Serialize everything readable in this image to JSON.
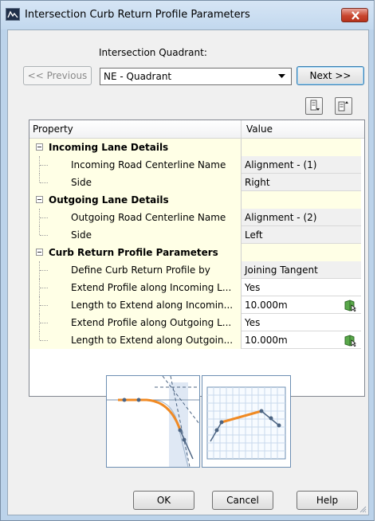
{
  "window": {
    "title": "Intersection Curb Return Profile Parameters",
    "icon": "dialog-app-icon",
    "close_icon": "close-icon"
  },
  "quadrant": {
    "label": "Intersection Quadrant:",
    "selected": "NE - Quadrant",
    "previous_label": "<< Previous",
    "next_label": "Next >>"
  },
  "grid": {
    "header_property": "Property",
    "header_value": "Value",
    "rows": [
      {
        "type": "category",
        "label": "Incoming Lane Details",
        "value": ""
      },
      {
        "type": "item",
        "label": "Incoming Road Centerline Name",
        "value": "Alignment - (1)",
        "readonly": true
      },
      {
        "type": "item",
        "label": "Side",
        "value": "Right",
        "readonly": true
      },
      {
        "type": "category",
        "label": "Outgoing Lane Details",
        "value": ""
      },
      {
        "type": "item",
        "label": "Outgoing Road Centerline Name",
        "value": "Alignment - (2)",
        "readonly": true
      },
      {
        "type": "item",
        "label": "Side",
        "value": "Left",
        "readonly": true
      },
      {
        "type": "category",
        "label": "Curb Return Profile Parameters",
        "value": ""
      },
      {
        "type": "item",
        "label": "Define Curb Return Profile by",
        "value": "Joining Tangent",
        "readonly": true
      },
      {
        "type": "item",
        "label": "Extend Profile along Incoming L...",
        "value": "Yes",
        "readonly": false
      },
      {
        "type": "item",
        "label": "Length to Extend along Incomin...",
        "value": "10.000m",
        "readonly": false,
        "pick": true
      },
      {
        "type": "item",
        "label": "Extend Profile along Outgoing L...",
        "value": "Yes",
        "readonly": false
      },
      {
        "type": "item",
        "label": "Length to Extend along Outgoin...",
        "value": "10.000m",
        "readonly": false,
        "pick": true
      }
    ]
  },
  "toolbar": {
    "collapse_icon": "collapse-all-icon",
    "expand_icon": "expand-all-icon"
  },
  "footer": {
    "ok_label": "OK",
    "cancel_label": "Cancel",
    "help_label": "Help"
  },
  "colors": {
    "accent_orange": "#f08a24",
    "category_bg": "#ffffe6",
    "title_bar": "#c2d8ee"
  }
}
